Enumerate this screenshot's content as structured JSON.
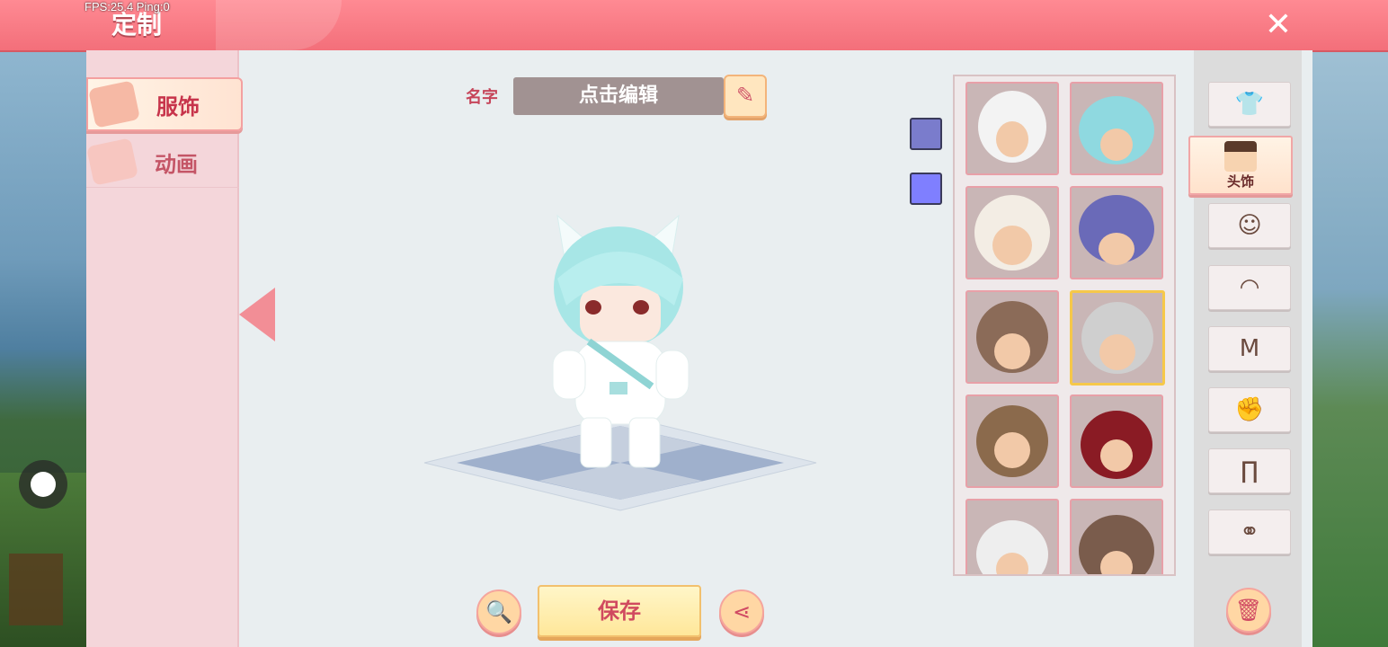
{
  "hud": {
    "fps": "FPS:25.4  Ping:0"
  },
  "header": {
    "title": "定制",
    "close_icon": "close-icon"
  },
  "left_nav": {
    "items": [
      {
        "label": "服饰",
        "icon": "tshirt-icon",
        "active": true
      },
      {
        "label": "动画",
        "icon": "animation-icon",
        "active": false
      }
    ]
  },
  "name": {
    "label": "名字",
    "value": "点击编辑",
    "edit_icon": "pencil-icon"
  },
  "swatches": [
    {
      "color": "#7a7ccc"
    },
    {
      "color": "#7f7fff"
    }
  ],
  "item_grid": {
    "rows": 5,
    "columns": 2,
    "items": [
      {
        "icon": "white-haired-horned-headwear",
        "color": "#f3f3f3",
        "selected": false
      },
      {
        "icon": "blue-cake-hair-headwear",
        "color": "#8fd9e0",
        "selected": false
      },
      {
        "icon": "tiger-hood-headwear",
        "color": "#f3ede4",
        "selected": false
      },
      {
        "icon": "zigzag-helmet-headwear",
        "color": "#6a6ab8",
        "selected": false
      },
      {
        "icon": "braided-brown-hair",
        "color": "#8b6b58",
        "selected": false
      },
      {
        "icon": "grey-cat-ear-hair",
        "color": "#cfcfcf",
        "selected": true
      },
      {
        "icon": "panda-hood-headwear",
        "color": "#8b6a4c",
        "selected": false
      },
      {
        "icon": "red-crown-buns-hair",
        "color": "#8a1b24",
        "selected": false
      },
      {
        "icon": "bunny-ear-hair",
        "color": "#eeeeee",
        "selected": false
      },
      {
        "icon": "brown-wavy-hair",
        "color": "#7a5c4c",
        "selected": false
      }
    ]
  },
  "right_nav": {
    "active": {
      "label": "头饰",
      "icon": "head-icon"
    },
    "items": [
      {
        "icon": "outfit-icon"
      },
      {
        "icon": "face-icon"
      },
      {
        "icon": "mask-icon"
      },
      {
        "icon": "shirt-icon"
      },
      {
        "icon": "gloves-icon"
      },
      {
        "icon": "pants-icon"
      },
      {
        "icon": "shoes-icon"
      }
    ],
    "trash_icon": "trash-icon"
  },
  "bottom": {
    "save_label": "保存",
    "zoom_icon": "magnify-icon",
    "share_icon": "share-icon"
  },
  "colors": {
    "accent": "#f36f7a",
    "panel": "#e9eef0",
    "nav": "#f4d6da"
  }
}
